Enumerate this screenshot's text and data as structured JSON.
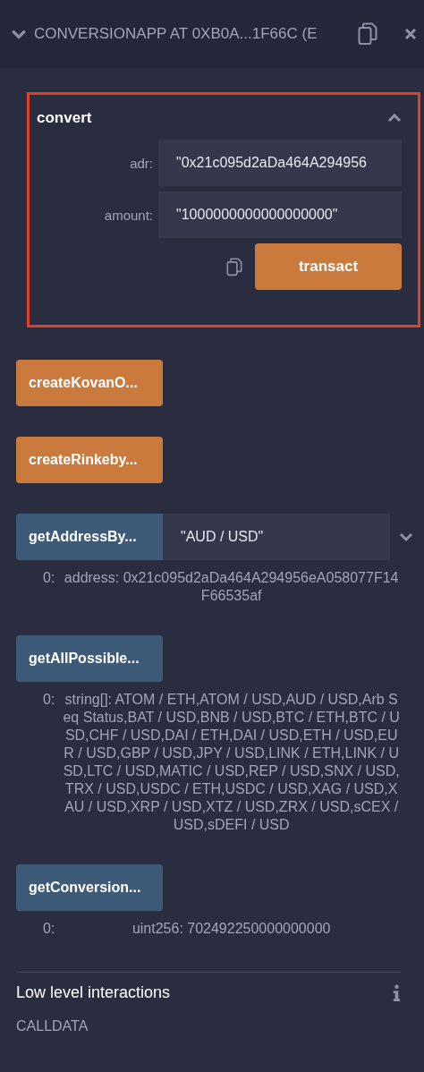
{
  "header": {
    "title": "CONVERSIONAPP AT 0XB0A...1F66C (E",
    "expanded": true
  },
  "convert": {
    "title": "convert",
    "expanded": true,
    "fields": [
      {
        "label": "adr:",
        "value": "\"0x21c095d2aDa464A294956"
      },
      {
        "label": "amount:",
        "value": "\"1000000000000000000\""
      }
    ],
    "button": "transact"
  },
  "functions": [
    {
      "kind": "transact",
      "label": "createKovanO..."
    },
    {
      "kind": "transact",
      "label": "createRinkeby..."
    },
    {
      "kind": "call",
      "label": "getAddressBy...",
      "input": "\"AUD / USD\"",
      "output": {
        "index": "0:",
        "value": "address: 0x21c095d2aDa464A294956eA058077F14F66535af"
      }
    },
    {
      "kind": "call",
      "label": "getAllPossible...",
      "output": {
        "index": "0:",
        "value": "string[]: ATOM / ETH,ATOM / USD,AUD / USD,Arb Seq Status,BAT / USD,BNB / USD,BTC / ETH,BTC / USD,CHF / USD,DAI / ETH,DAI / USD,ETH / USD,EUR / USD,GBP / USD,JPY / USD,LINK / ETH,LINK / USD,LTC / USD,MATIC / USD,REP / USD,SNX / USD,TRX / USD,USDC / ETH,USDC / USD,XAG / USD,XAU / USD,XRP / USD,XTZ / USD,ZRX / USD,sCEX / USD,sDEFI / USD"
      }
    },
    {
      "kind": "call",
      "label": "getConversion...",
      "output": {
        "index": "0:",
        "value": "uint256: 702492250000000000"
      }
    }
  ],
  "low_level": {
    "title": "Low level interactions",
    "calldata_label": "CALLDATA"
  }
}
